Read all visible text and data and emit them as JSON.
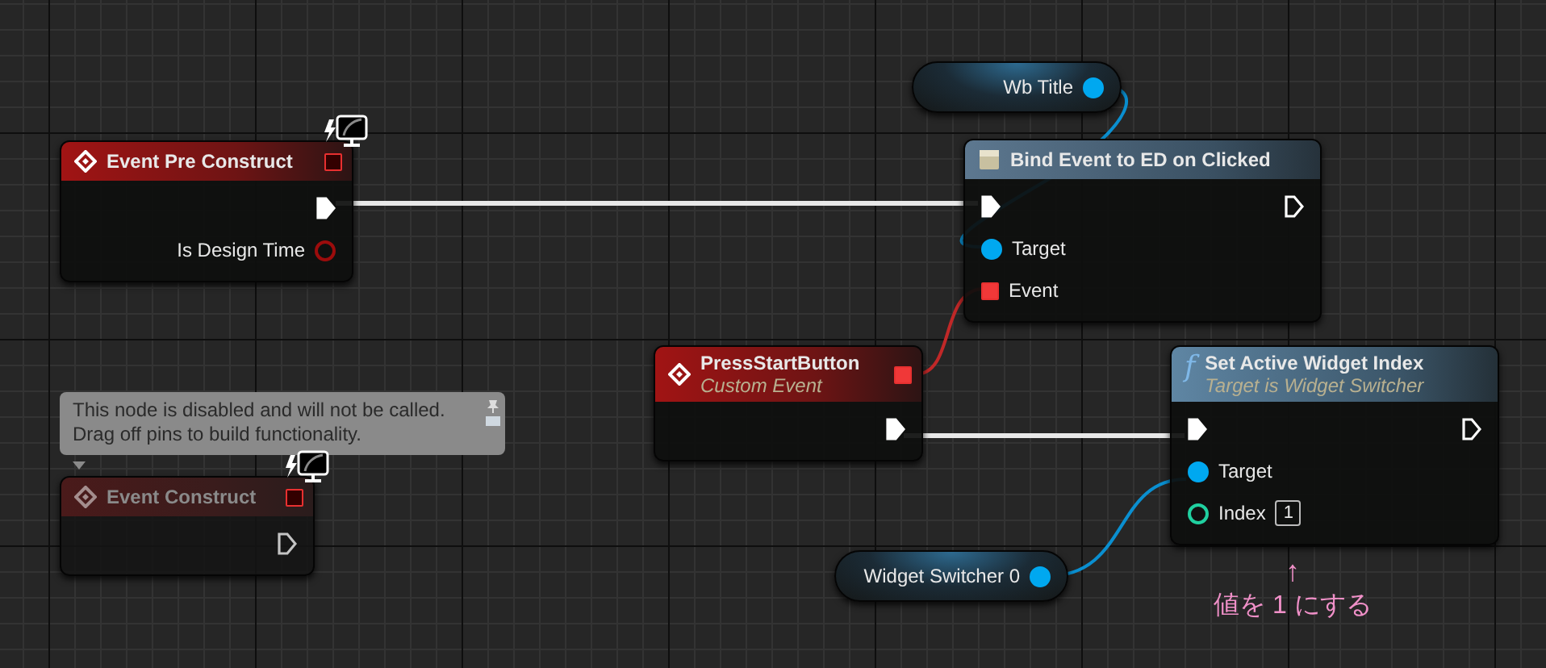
{
  "nodes": [
    {
      "kind": "variable",
      "title": "Wb Title",
      "out": {
        "kind": "object",
        "connected": true
      }
    },
    {
      "kind": "event",
      "title": "Event Pre Construct",
      "disabled": false,
      "lightning_badge": true,
      "header_pin": {
        "kind": "delegate",
        "connected": false
      },
      "rows": [
        {
          "out": {
            "kind": "exec",
            "connected": true
          }
        },
        {
          "out": {
            "kind": "bool",
            "label": "Is Design Time",
            "connected": false
          }
        }
      ]
    },
    {
      "kind": "bind",
      "title": "Bind Event to ED on Clicked",
      "disabled": false,
      "lightning_badge": false,
      "rows": [
        {
          "in": {
            "kind": "exec",
            "connected": true
          },
          "out": {
            "kind": "exec",
            "connected": false
          }
        },
        {
          "in": {
            "kind": "object",
            "label": "Target",
            "connected": true
          }
        },
        {
          "in": {
            "kind": "delegate",
            "label": "Event",
            "connected": true
          }
        }
      ]
    },
    {
      "kind": "event",
      "title": "PressStartButton",
      "subtitle": "Custom Event",
      "disabled": false,
      "lightning_badge": false,
      "header_pin": {
        "kind": "delegate",
        "connected": true
      },
      "rows": [
        {
          "out": {
            "kind": "exec",
            "connected": true
          }
        }
      ]
    },
    {
      "kind": "function",
      "glyph": "f",
      "title": "Set Active Widget Index",
      "subtitle": "Target is Widget Switcher",
      "disabled": false,
      "lightning_badge": false,
      "rows": [
        {
          "in": {
            "kind": "exec",
            "connected": true
          },
          "out": {
            "kind": "exec",
            "connected": false
          }
        },
        {
          "in": {
            "kind": "object",
            "label": "Target",
            "connected": true
          }
        },
        {
          "in": {
            "kind": "int",
            "label": "Index",
            "value": "1",
            "connected": false
          }
        }
      ]
    },
    {
      "kind": "event",
      "title": "Event Construct",
      "disabled": true,
      "lightning_badge": true,
      "comment": "This node is disabled and will not be called.\nDrag off pins to build functionality.",
      "header_pin": {
        "kind": "delegate",
        "connected": false
      },
      "rows": [
        {
          "out": {
            "kind": "exec",
            "connected": false
          }
        }
      ]
    },
    {
      "kind": "variable",
      "title": "Widget Switcher 0",
      "out": {
        "kind": "object",
        "connected": true
      }
    }
  ],
  "annotation": {
    "arrow": "↑",
    "text": "値を 1 にする"
  }
}
